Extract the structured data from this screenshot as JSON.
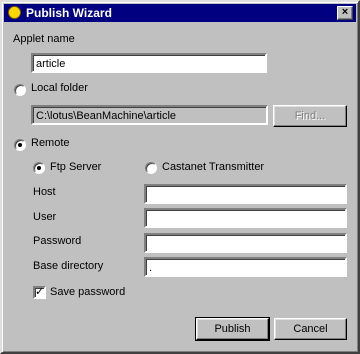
{
  "window": {
    "title": "Publish Wizard",
    "close_label": "×"
  },
  "applet": {
    "label": "Applet name",
    "value": "article"
  },
  "local": {
    "label": "Local folder",
    "path": "C:\\lotus\\BeanMachine\\article",
    "find_label": "Find...",
    "selected": false
  },
  "remote": {
    "label": "Remote",
    "selected": true,
    "ftp_label": "Ftp Server",
    "castanet_label": "Castanet Transmitter",
    "host_label": "Host",
    "host_value": "",
    "user_label": "User",
    "user_value": "",
    "password_label": "Password",
    "password_value": "",
    "basedir_label": "Base directory",
    "basedir_value": ".",
    "save_password_label": "Save password",
    "save_password_checked": true
  },
  "buttons": {
    "publish": "Publish",
    "cancel": "Cancel"
  }
}
